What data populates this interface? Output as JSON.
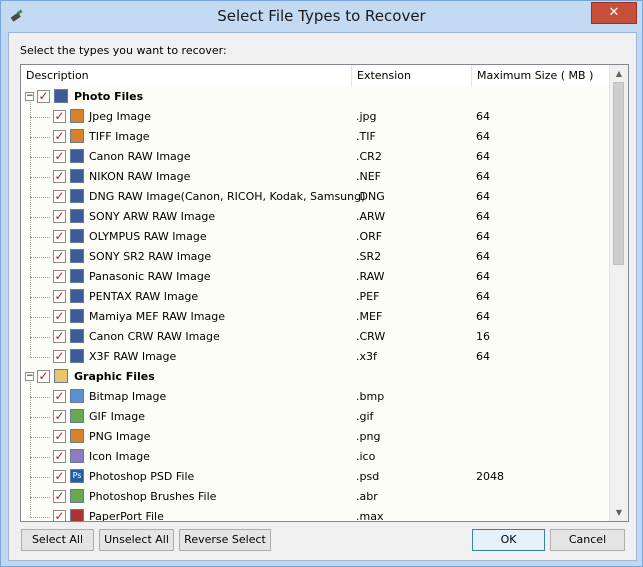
{
  "window": {
    "title": "Select File Types to Recover",
    "close_glyph": "✕"
  },
  "prompt": "Select the types you want to recover:",
  "columns": {
    "description": "Description",
    "extension": "Extension",
    "max_size": "Maximum Size ( MB )"
  },
  "groups": [
    {
      "name": "Photo Files",
      "icon": "photo-group-icon",
      "expander": "−",
      "items": [
        {
          "desc": "Jpeg Image",
          "ext": ".jpg",
          "size": "64",
          "icon": "jpeg-file-icon",
          "color": "#d9822b"
        },
        {
          "desc": "TIFF Image",
          "ext": ".TIF",
          "size": "64",
          "icon": "tiff-file-icon",
          "color": "#d9822b"
        },
        {
          "desc": "Canon RAW Image",
          "ext": ".CR2",
          "size": "64",
          "icon": "raw-file-icon",
          "color": "#3b5b9a"
        },
        {
          "desc": "NIKON RAW Image",
          "ext": ".NEF",
          "size": "64",
          "icon": "raw-file-icon",
          "color": "#3b5b9a"
        },
        {
          "desc": "DNG RAW Image(Canon, RICOH, Kodak, Samsung)",
          "ext": ".DNG",
          "size": "64",
          "icon": "raw-file-icon",
          "color": "#3b5b9a"
        },
        {
          "desc": "SONY ARW RAW Image",
          "ext": ".ARW",
          "size": "64",
          "icon": "raw-file-icon",
          "color": "#3b5b9a"
        },
        {
          "desc": "OLYMPUS RAW Image",
          "ext": ".ORF",
          "size": "64",
          "icon": "raw-file-icon",
          "color": "#3b5b9a"
        },
        {
          "desc": "SONY SR2 RAW Image",
          "ext": ".SR2",
          "size": "64",
          "icon": "raw-file-icon",
          "color": "#3b5b9a"
        },
        {
          "desc": "Panasonic RAW Image",
          "ext": ".RAW",
          "size": "64",
          "icon": "raw-file-icon",
          "color": "#3b5b9a"
        },
        {
          "desc": "PENTAX RAW Image",
          "ext": ".PEF",
          "size": "64",
          "icon": "raw-file-icon",
          "color": "#3b5b9a"
        },
        {
          "desc": "Mamiya MEF RAW Image",
          "ext": ".MEF",
          "size": "64",
          "icon": "raw-file-icon",
          "color": "#3b5b9a"
        },
        {
          "desc": "Canon CRW RAW Image",
          "ext": ".CRW",
          "size": "16",
          "icon": "raw-file-icon",
          "color": "#3b5b9a"
        },
        {
          "desc": "X3F RAW Image",
          "ext": ".x3f",
          "size": "64",
          "icon": "raw-file-icon",
          "color": "#3b5b9a"
        }
      ]
    },
    {
      "name": "Graphic Files",
      "icon": "graphic-group-icon",
      "expander": "−",
      "items": [
        {
          "desc": "Bitmap Image",
          "ext": ".bmp",
          "size": "",
          "icon": "bitmap-file-icon",
          "color": "#5b8fd0"
        },
        {
          "desc": "GIF Image",
          "ext": ".gif",
          "size": "",
          "icon": "gif-file-icon",
          "color": "#6aa84f"
        },
        {
          "desc": "PNG Image",
          "ext": ".png",
          "size": "",
          "icon": "png-file-icon",
          "color": "#d9822b"
        },
        {
          "desc": "Icon Image",
          "ext": ".ico",
          "size": "",
          "icon": "ico-file-icon",
          "color": "#8e7cc3"
        },
        {
          "desc": "Photoshop PSD File",
          "ext": ".psd",
          "size": "2048",
          "icon": "photoshop-psd-icon",
          "color": "#1f5fa8",
          "glyph": "Ps"
        },
        {
          "desc": "Photoshop Brushes File",
          "ext": ".abr",
          "size": "",
          "icon": "photoshop-brush-icon",
          "color": "#6aa84f"
        },
        {
          "desc": "PaperPort File",
          "ext": ".max",
          "size": "",
          "icon": "paperport-file-icon",
          "color": "#a33"
        }
      ]
    }
  ],
  "check_glyph": "✓",
  "scroll": {
    "up": "▲",
    "down": "▼"
  },
  "buttons": {
    "select_all": "Select All",
    "unselect_all": "Unselect All",
    "reverse_select": "Reverse Select",
    "ok": "OK",
    "cancel": "Cancel"
  }
}
